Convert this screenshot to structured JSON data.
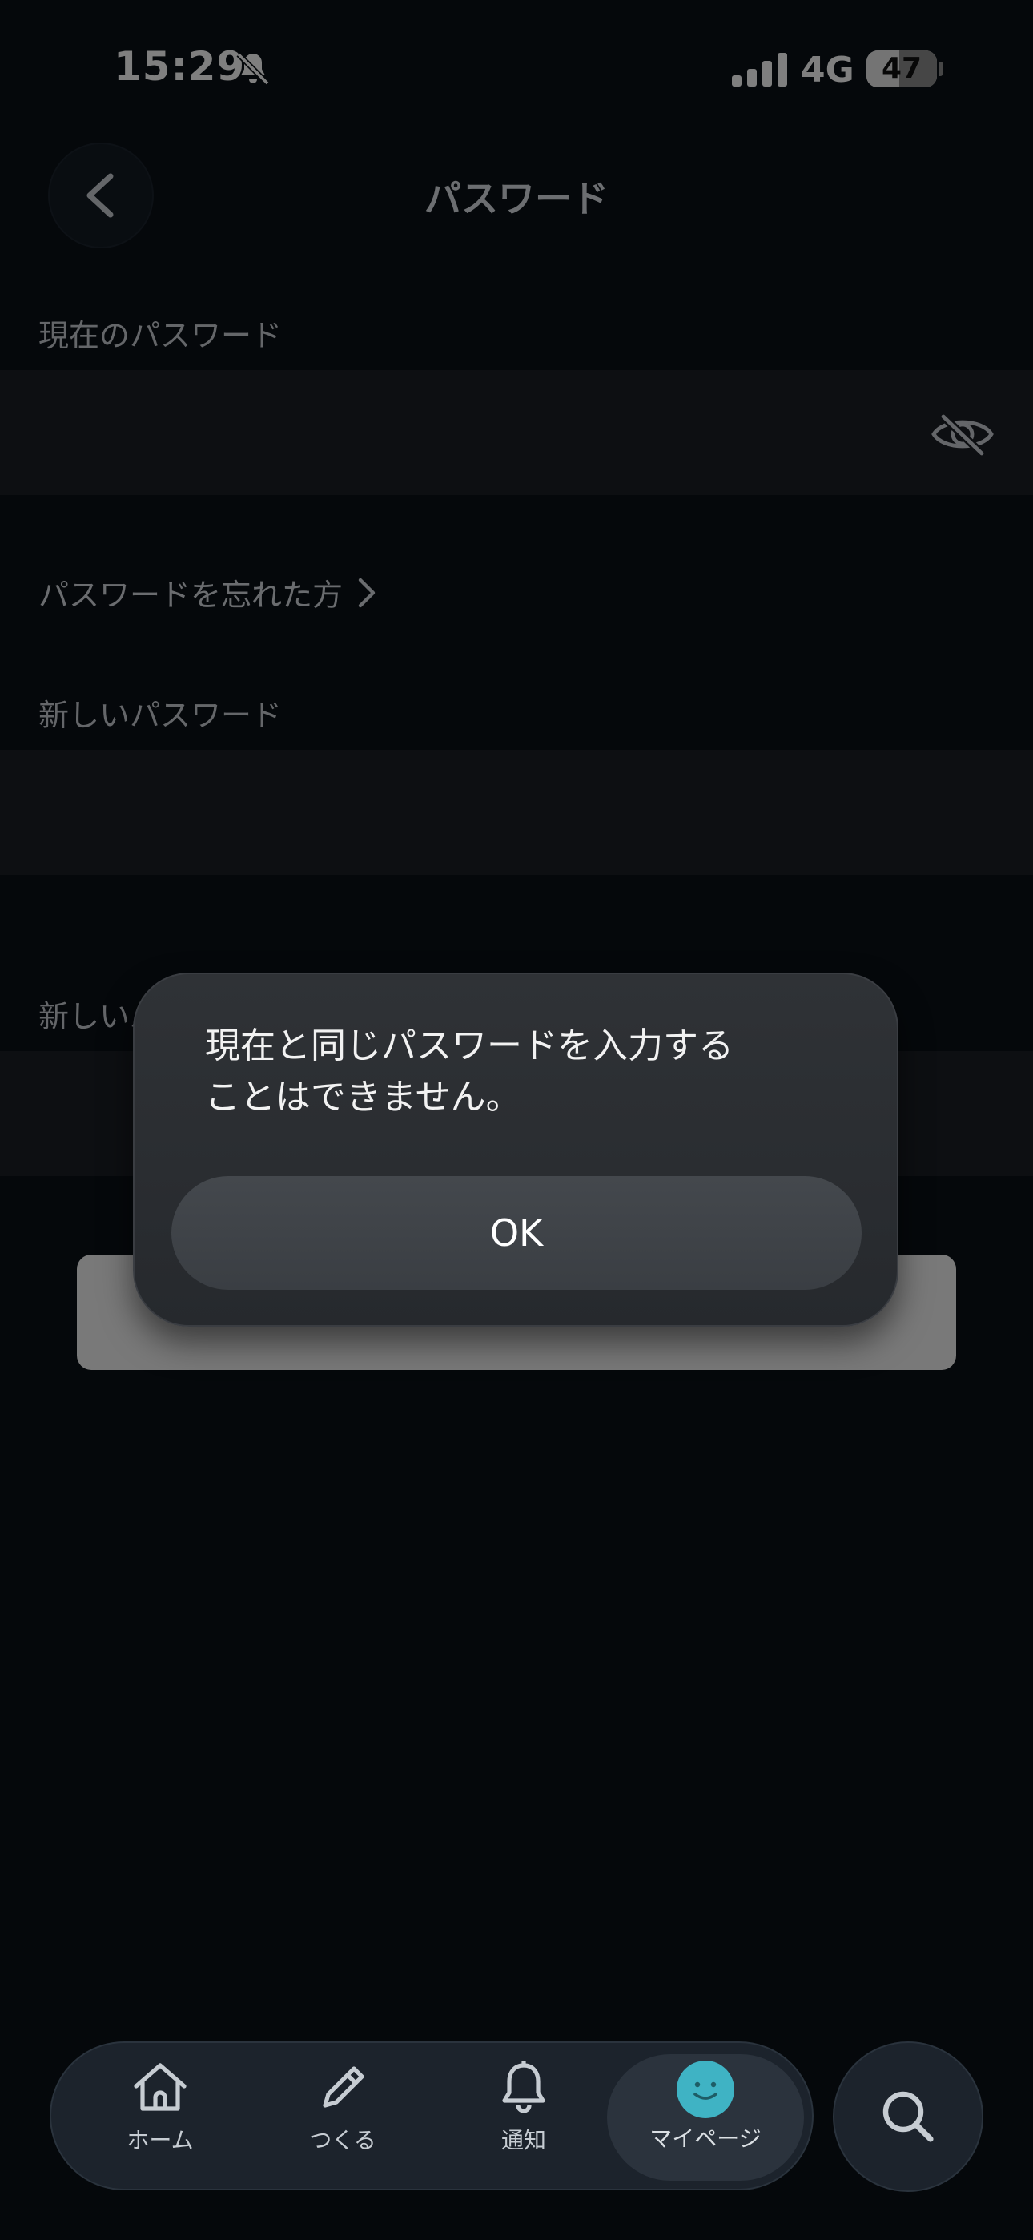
{
  "status_bar": {
    "time": "15:29",
    "network": "4G",
    "battery_percent": "47",
    "battery_level": 0.47,
    "icons": [
      "bell-slash-icon",
      "signal-icon",
      "battery-icon"
    ]
  },
  "header": {
    "title": "パスワード",
    "back_icon": "chevron-left-icon"
  },
  "form": {
    "current_password_label": "現在のパスワード",
    "current_password_value": "",
    "visibility_icon": "eye-slash-icon",
    "forgot_link": "パスワードを忘れた方",
    "new_password_label": "新しいパスワード",
    "new_password_value": "",
    "confirm_password_label_partial": "新しいパ",
    "confirm_password_value": ""
  },
  "alert": {
    "message_line1": "現在と同じパスワードを入力する",
    "message_line2": "ことはできません。",
    "ok_label": "OK"
  },
  "tab_bar": {
    "items": [
      {
        "label": "ホーム",
        "icon": "home-icon"
      },
      {
        "label": "つくる",
        "icon": "pencil-icon"
      },
      {
        "label": "通知",
        "icon": "bell-icon"
      },
      {
        "label": "マイページ",
        "icon": "avatar-icon",
        "active": true
      }
    ],
    "search_icon": "search-icon"
  },
  "colors": {
    "background": "#0b1016",
    "field": "#1a1f25",
    "accent_avatar": "#3fb3c4",
    "alert_bg": "#2f3236"
  }
}
